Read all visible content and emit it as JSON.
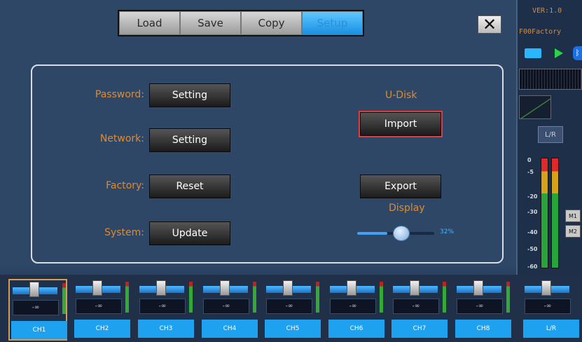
{
  "tabs": [
    {
      "label": "Load"
    },
    {
      "label": "Save"
    },
    {
      "label": "Copy"
    },
    {
      "label": "Setup",
      "active": true
    }
  ],
  "close_label": "✕",
  "setup": {
    "password_label": "Password:",
    "password_button": "Setting",
    "network_label": "Network:",
    "network_button": "Setting",
    "factory_label": "Factory:",
    "factory_button": "Reset",
    "system_label": "System:",
    "system_button": "Update",
    "udisk_label": "U-Disk",
    "import_button": "Import",
    "export_button": "Export",
    "display_label": "Display",
    "display_brightness": "32%",
    "display_brightness_value": 32
  },
  "sidebar": {
    "version": "VER:1.0",
    "preset": "F00Factory",
    "bluetooth_glyph": "ᛒ",
    "lr_label": "L/R",
    "scale": [
      "0",
      "-5",
      "-20",
      "-30",
      "-40",
      "-50",
      "-60"
    ],
    "m1": "M1",
    "m2": "M2"
  },
  "channels": [
    {
      "label": "CH1",
      "value": "-∞",
      "selected": true
    },
    {
      "label": "CH2",
      "value": "-∞"
    },
    {
      "label": "CH3",
      "value": "-∞"
    },
    {
      "label": "CH4",
      "value": "-∞"
    },
    {
      "label": "CH5",
      "value": "-∞"
    },
    {
      "label": "CH6",
      "value": "-∞"
    },
    {
      "label": "CH7",
      "value": "-∞"
    },
    {
      "label": "CH8",
      "value": "-∞"
    },
    {
      "label": "L/R",
      "value": "-∞"
    }
  ],
  "colors": {
    "accent": "#1ea2f0",
    "label_orange": "#e08a2e",
    "panel_bg": "#2e4767",
    "highlight_red": "#e53b3b"
  }
}
